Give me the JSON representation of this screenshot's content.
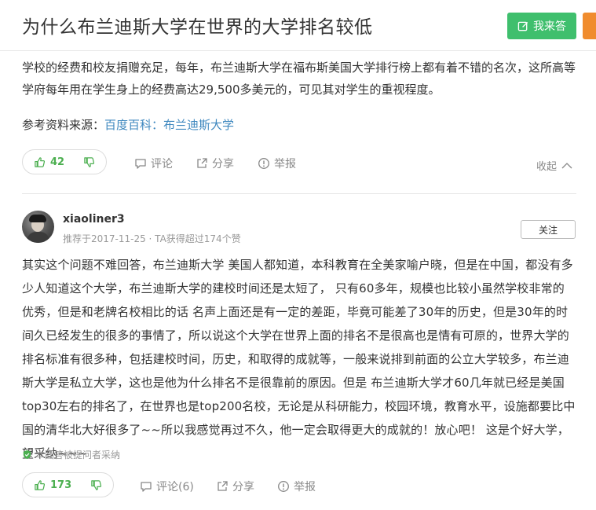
{
  "header": {
    "title": "为什么布兰迪斯大学在世界的大学排名较低",
    "answer_button": "我来答"
  },
  "answer1": {
    "paragraph": "学校的经费和校友捐赠充足，每年，布兰迪斯大学在福布斯美国大学排行榜上都有着不错的名次，这所高等学府每年用在学生身上的经费高达29,500多美元的，可见其对学生的重视程度。",
    "reference_label": "参考资料来源：",
    "reference_link": "百度百科：布兰迪斯大学",
    "likes": "42",
    "comment_label": "评论",
    "share_label": "分享",
    "report_label": "举报",
    "collapse_label": "收起"
  },
  "answer2": {
    "username": "xiaoliner3",
    "meta": "推荐于2017-11-25 · TA获得超过174个赞",
    "follow_label": "关注",
    "paragraph": "其实这个问题不难回答，布兰迪斯大学 美国人都知道，本科教育在全美家喻户晓，但是在中国，都没有多少人知道这个大学，布兰迪斯大学的建校时间还是太短了， 只有60多年，规模也比较小虽然学校非常的优秀，但是和老牌名校相比的话 名声上面还是有一定的差距，毕竟可能差了30年的历史，但是30年的时间久已经发生的很多的事情了，所以说这个大学在世界上面的排名不是很高也是情有可原的，世界大学的排名标准有很多种，包括建校时间，历史，和取得的成就等，一般来说排到前面的公立大学较多，布兰迪斯大学是私立大学，这也是他为什么排名不是很靠前的原因。但是 布兰迪斯大学才60几年就已经是美国top30左右的排名了，在世界也是top200名校，无论是从科研能力，校园环境，教育水平，设施都要比中国的清华北大好很多了~~所以我感觉再过不久，他一定会取得更大的成就的！放心吧！ 这是个好大学，望采纳~~~",
    "adopted_label": "本回答被提问者采纳",
    "likes": "173",
    "comment_label": "评论(6)",
    "share_label": "分享",
    "report_label": "举报"
  },
  "colors": {
    "accent_green": "#3fbf6d",
    "link_blue": "#3f88bf",
    "side_tab_orange": "#f08c2e"
  }
}
